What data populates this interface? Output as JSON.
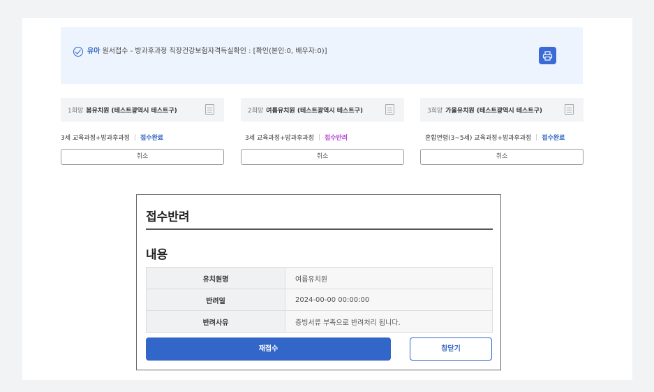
{
  "notice": {
    "highlight": "유아",
    "text": "원서접수 - 방과후과정 직장건강보험자격득실확인 : [확인(본인:0, 배우자:0)]"
  },
  "choices": [
    {
      "rank": "1희망",
      "name": "봄유치원 (테스트광역시 테스트구)",
      "course": "3세 교육과정+방과후과정",
      "status": "접수완료",
      "cancel": "취소"
    },
    {
      "rank": "2희망",
      "name": "여름유치원 (테스트광역시 테스트구)",
      "course": "3세 교육과정+방과후과정",
      "status": "접수반려",
      "cancel": "취소"
    },
    {
      "rank": "3희망",
      "name": "가을유치원 (테스트광역시 테스트구)",
      "course": "혼합연령(3~5세) 교육과정+방과후과정",
      "status": "접수완료",
      "cancel": "취소"
    }
  ],
  "modal": {
    "title": "접수반려",
    "section": "내용",
    "rows": [
      {
        "label": "유치원명",
        "value": "여름유치원"
      },
      {
        "label": "반려일",
        "value": "2024-00-00 00:00:00"
      },
      {
        "label": "반려사유",
        "value": "증빙서류 부족으로 반려처리 됩니다."
      }
    ],
    "resubmit": "재접수",
    "close": "창닫기"
  },
  "colors": {
    "accent": "#3366c9",
    "rejected": "#b64bd6",
    "notice_bg": "#eef4fd"
  },
  "icons": {
    "check": "check-circle-icon",
    "print": "printer-icon",
    "document": "document-icon"
  }
}
